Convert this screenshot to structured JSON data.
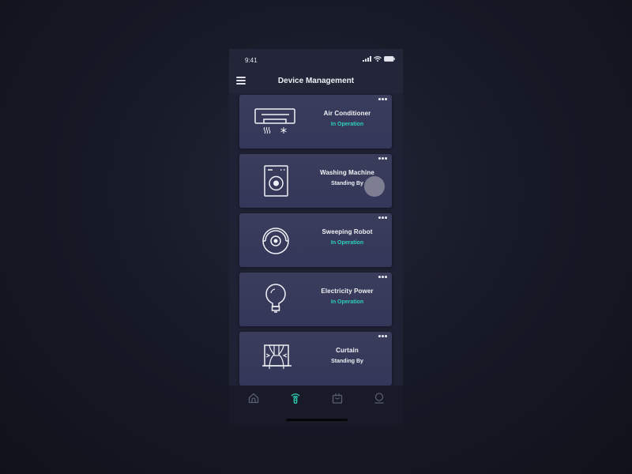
{
  "status_bar": {
    "time": "9:41",
    "icons": [
      "signal-icon",
      "wifi-icon",
      "battery-icon"
    ]
  },
  "header": {
    "menu_icon": "hamburger-menu-icon",
    "title": "Device Management"
  },
  "devices": [
    {
      "name": "Air Conditioner",
      "status": "In Operation",
      "active": true,
      "icon": "air-conditioner-icon"
    },
    {
      "name": "Washing Machine",
      "status": "Standing By",
      "active": false,
      "icon": "washing-machine-icon"
    },
    {
      "name": "Sweeping Robot",
      "status": "In Operation",
      "active": true,
      "icon": "sweeping-robot-icon"
    },
    {
      "name": "Electricity Power",
      "status": "In Operation",
      "active": true,
      "icon": "light-bulb-icon"
    },
    {
      "name": "Curtain",
      "status": "Standing By",
      "active": false,
      "icon": "curtain-icon"
    }
  ],
  "tab_bar": {
    "tabs": [
      {
        "name": "home",
        "icon": "home-icon",
        "active": false
      },
      {
        "name": "devices",
        "icon": "remote-signal-icon",
        "active": true
      },
      {
        "name": "shop",
        "icon": "shopping-bag-icon",
        "active": false
      },
      {
        "name": "profile",
        "icon": "user-icon",
        "active": false
      }
    ]
  },
  "colors": {
    "accent": "#2fd0b8",
    "card": "#383b58",
    "background": "#1f2134",
    "tab_inactive": "#5a5d74"
  }
}
